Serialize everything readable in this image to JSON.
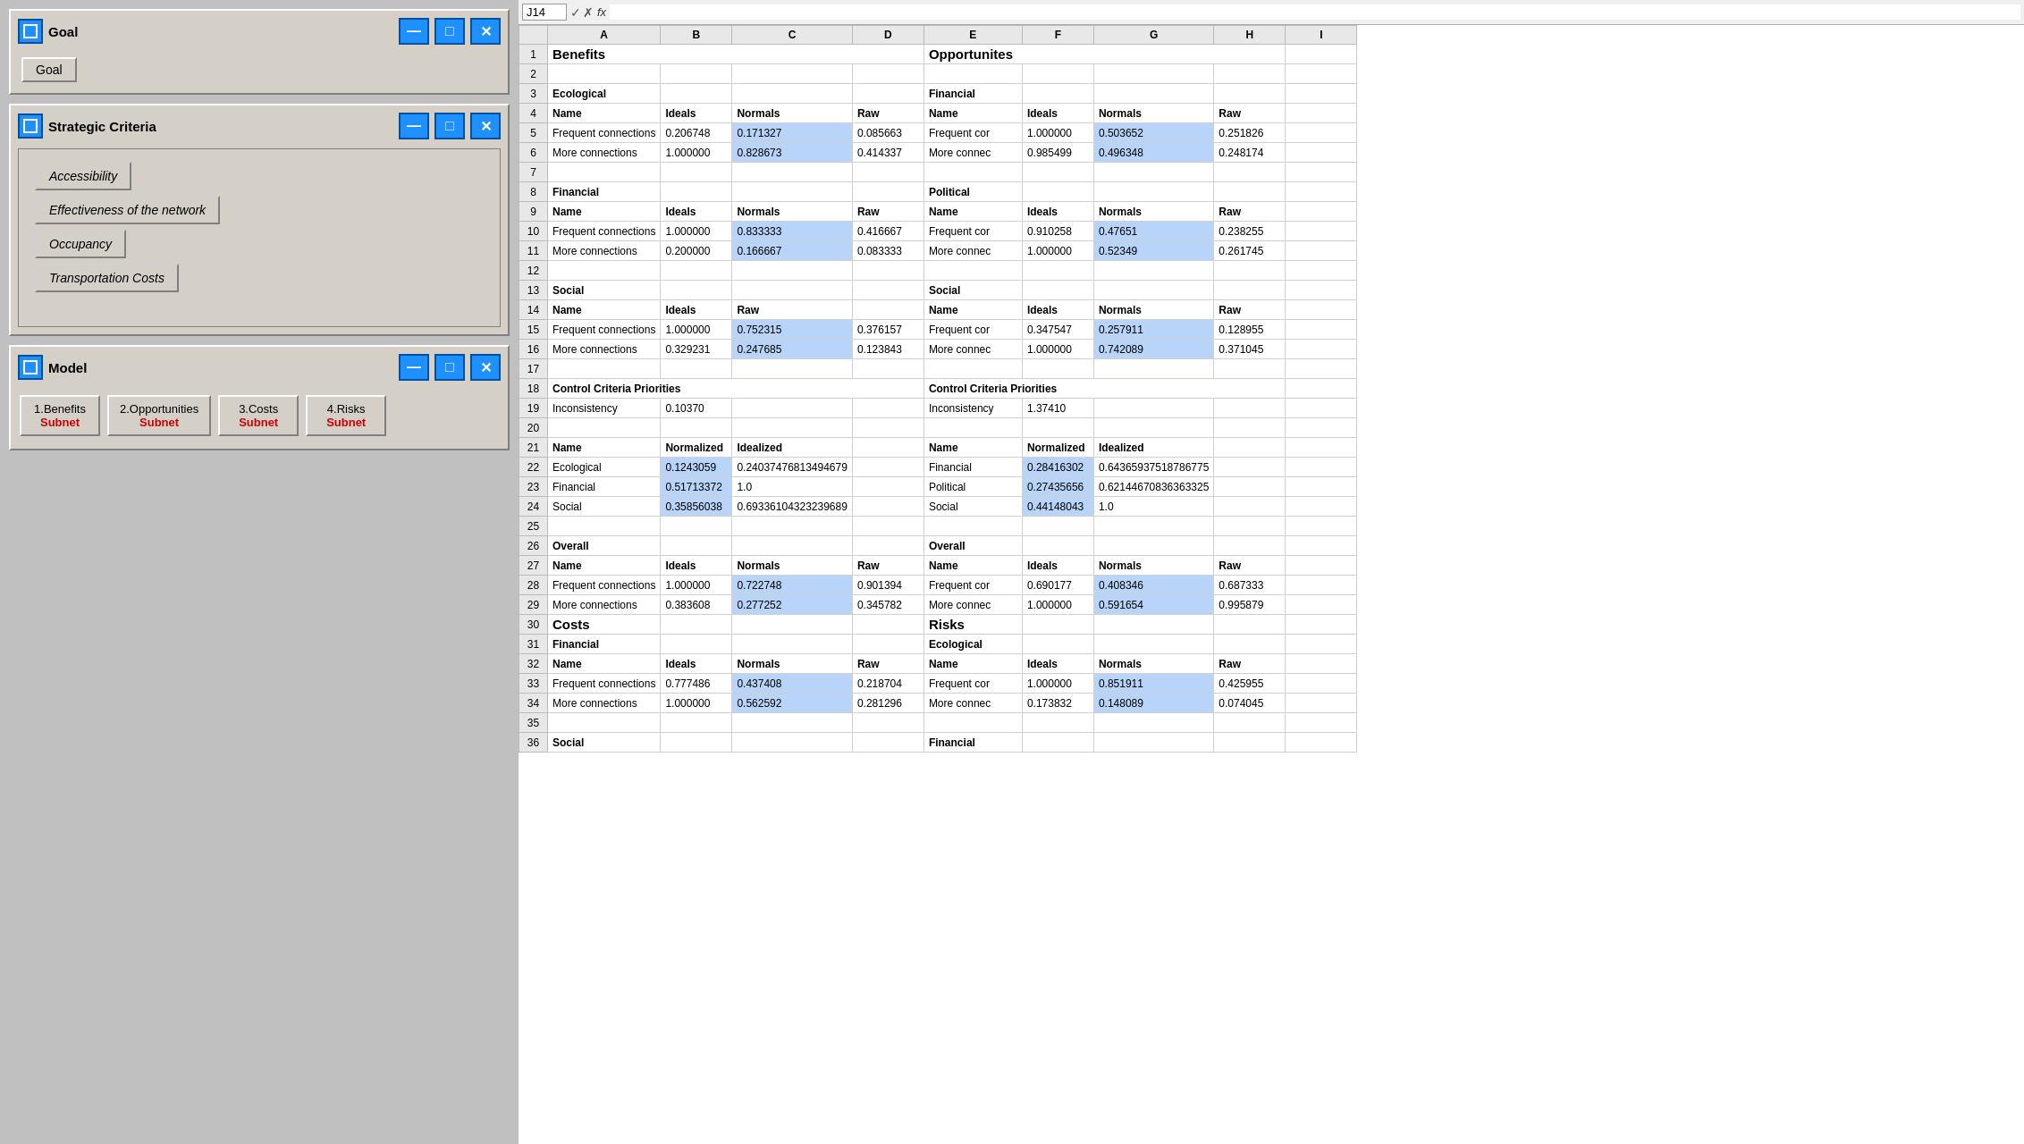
{
  "leftPanel": {
    "goalWindow": {
      "title": "Goal",
      "buttons": [
        "minimize",
        "maximize",
        "close"
      ],
      "goalLabel": "Goal"
    },
    "strategicCriteriaWindow": {
      "title": "Strategic Criteria",
      "buttons": [
        "minimize",
        "maximize",
        "close"
      ],
      "criteria": [
        {
          "label": "Accessibility"
        },
        {
          "label": "Effectiveness of the network"
        },
        {
          "label": "Occupancy"
        },
        {
          "label": "Transportation Costs"
        }
      ]
    },
    "modelWindow": {
      "title": "Model",
      "buttons": [
        "minimize",
        "maximize",
        "close"
      ],
      "subnets": [
        {
          "title": "1.Benefits",
          "sub": "Subnet"
        },
        {
          "title": "2.Opportunities",
          "sub": "Subnet"
        },
        {
          "title": "3.Costs",
          "sub": "Subnet"
        },
        {
          "title": "4.Risks",
          "sub": "Subnet"
        }
      ]
    }
  },
  "excel": {
    "cellRef": "J14",
    "formulaBar": "",
    "columns": [
      "",
      "A",
      "B",
      "C",
      "D",
      "E",
      "F",
      "G",
      "H",
      "I"
    ],
    "rows": {
      "1": {
        "a": "Benefits",
        "e": "Opportunites"
      },
      "2": {},
      "3": {
        "a": "Ecological",
        "e": "Financial"
      },
      "4": {
        "a": "Name",
        "b": "Ideals",
        "c": "Normals",
        "d": "Raw",
        "e": "Name",
        "f": "Ideals",
        "g": "Normals",
        "h": "Raw"
      },
      "5": {
        "a": "Frequent connections",
        "b": "0.206748",
        "c": "0.171327",
        "d": "0.085663",
        "e": "Frequent cor",
        "f": "1.000000",
        "g": "0.503652",
        "h": "0.251826"
      },
      "6": {
        "a": "More connections",
        "b": "1.000000",
        "c": "0.828673",
        "d": "0.414337",
        "e": "More connec",
        "f": "0.985499",
        "g": "0.496348",
        "h": "0.248174"
      },
      "7": {},
      "8": {
        "a": "Financial",
        "e": "Political"
      },
      "9": {
        "a": "Name",
        "b": "Ideals",
        "c": "Normals",
        "d": "Raw",
        "e": "Name",
        "f": "Ideals",
        "g": "Normals",
        "h": "Raw"
      },
      "10": {
        "a": "Frequent connections",
        "b": "1.000000",
        "c": "0.833333",
        "d": "0.416667",
        "e": "Frequent cor",
        "f": "0.910258",
        "g": "0.47651",
        "h": "0.238255"
      },
      "11": {
        "a": "More connections",
        "b": "0.200000",
        "c": "0.166667",
        "d": "0.083333",
        "e": "More connec",
        "f": "1.000000",
        "g": "0.52349",
        "h": "0.261745"
      },
      "12": {},
      "13": {
        "a": "Social",
        "e": "Social"
      },
      "14": {
        "a": "Name",
        "b": "Ideals",
        "c": "Raw",
        "e": "Name",
        "f": "Ideals",
        "g": "Normals",
        "h": "Raw"
      },
      "15": {
        "a": "Frequent connections",
        "b": "1.000000",
        "c": "0.752315",
        "d": "0.376157",
        "e": "Frequent cor",
        "f": "0.347547",
        "g": "0.257911",
        "h": "0.128955"
      },
      "16": {
        "a": "More connections",
        "b": "0.329231",
        "c": "0.247685",
        "d": "0.123843",
        "e": "More connec",
        "f": "1.000000",
        "g": "0.742089",
        "h": "0.371045"
      },
      "17": {},
      "18": {
        "a": "Control Criteria Priorities",
        "e": "Control Criteria Priorities"
      },
      "19": {
        "a": "Inconsistency",
        "b": "0.10370",
        "e": "Inconsistency",
        "f": "1.37410"
      },
      "20": {},
      "21": {
        "a": "Name",
        "b": "Normalized",
        "c": "Idealized",
        "e": "Name",
        "f": "Normalized",
        "g": "Idealized"
      },
      "22": {
        "a": "Ecological",
        "b": "0.1243059",
        "c": "0.24037476813494679",
        "e": "Financial",
        "f": "0.28416302",
        "g": "0.64365937518786775"
      },
      "23": {
        "a": "Financial",
        "b": "0.51713372",
        "c": "1.0",
        "e": "Political",
        "f": "0.27435656",
        "g": "0.62144670836363325"
      },
      "24": {
        "a": "Social",
        "b": "0.35856038",
        "c": "0.69336104323239689",
        "e": "Social",
        "f": "0.44148043",
        "g": "1.0"
      },
      "25": {},
      "26": {
        "a": "Overall",
        "e": "Overall"
      },
      "27": {
        "a": "Name",
        "b": "Ideals",
        "c": "Normals",
        "d": "Raw",
        "e": "Name",
        "f": "Ideals",
        "g": "Normals",
        "h": "Raw"
      },
      "28": {
        "a": "Frequent connections",
        "b": "1.000000",
        "c": "0.722748",
        "d": "0.901394",
        "e": "Frequent cor",
        "f": "0.690177",
        "g": "0.408346",
        "h": "0.687333"
      },
      "29": {
        "a": "More connections",
        "b": "0.383608",
        "c": "0.277252",
        "d": "0.345782",
        "e": "More connec",
        "f": "1.000000",
        "g": "0.591654",
        "h": "0.995879"
      },
      "30": {
        "a": "Costs",
        "e": "Risks"
      },
      "31": {
        "a": "Financial",
        "e": "Ecological"
      },
      "32": {
        "a": "Name",
        "b": "Ideals",
        "c": "Normals",
        "d": "Raw",
        "e": "Name",
        "f": "Ideals",
        "g": "Normals",
        "h": "Raw"
      },
      "33": {
        "a": "Frequent connections",
        "b": "0.777486",
        "c": "0.437408",
        "d": "0.218704",
        "e": "Frequent cor",
        "f": "1.000000",
        "g": "0.851911",
        "h": "0.425955"
      },
      "34": {
        "a": "More connections",
        "b": "1.000000",
        "c": "0.562592",
        "d": "0.281296",
        "e": "More connec",
        "f": "0.173832",
        "g": "0.148089",
        "h": "0.074045"
      },
      "35": {},
      "36": {
        "a": "Social",
        "e": "Financial"
      }
    }
  }
}
